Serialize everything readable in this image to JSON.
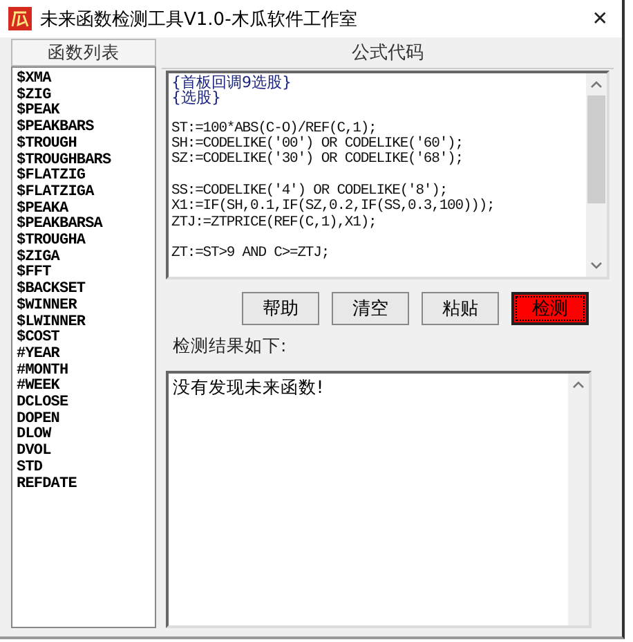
{
  "window": {
    "title": "未来函数检测工具V1.0-木瓜软件工作室",
    "close": "✕"
  },
  "function_list": {
    "header": "函数列表",
    "items": [
      "$XMA",
      "$ZIG",
      "$PEAK",
      "$PEAKBARS",
      "$TROUGH",
      "$TROUGHBARS",
      "$FLATZIG",
      "$FLATZIGA",
      "$PEAKA",
      "$PEAKBARSA",
      "$TROUGHA",
      "$ZIGA",
      "$FFT",
      "$BACKSET",
      "$WINNER",
      "$LWINNER",
      "$COST",
      "#YEAR",
      "#MONTH",
      "#WEEK",
      "DCLOSE",
      "DOPEN",
      "DLOW",
      "DVOL",
      "STD",
      "REFDATE"
    ]
  },
  "formula": {
    "header": "公式代码",
    "lines": [
      {
        "kind": "comment",
        "text": "{首板回调9选股}"
      },
      {
        "kind": "comment",
        "text": "{选股}"
      },
      {
        "kind": "blank"
      },
      {
        "kind": "code",
        "text": "ST:=100*ABS(C-O)/REF(C,1);"
      },
      {
        "kind": "code",
        "text": "SH:=CODELIKE('00') OR CODELIKE('60');"
      },
      {
        "kind": "code",
        "text": "SZ:=CODELIKE('30') OR CODELIKE('68');"
      },
      {
        "kind": "blank"
      },
      {
        "kind": "code",
        "text": "SS:=CODELIKE('4') OR CODELIKE('8');"
      },
      {
        "kind": "code",
        "text": "X1:=IF(SH,0.1,IF(SZ,0.2,IF(SS,0.3,100)));"
      },
      {
        "kind": "code",
        "text": "ZTJ:=ZTPRICE(REF(C,1),X1);"
      },
      {
        "kind": "blank"
      },
      {
        "kind": "code",
        "text": "ZT:=ST>9 AND C>=ZTJ;"
      }
    ]
  },
  "buttons": [
    {
      "label": "帮助",
      "highlighted": false
    },
    {
      "label": "清空",
      "highlighted": false
    },
    {
      "label": "粘贴",
      "highlighted": false
    },
    {
      "label": "检测",
      "highlighted": true
    }
  ],
  "result": {
    "label": "检测结果如下:",
    "text": "没有发现未来函数!"
  }
}
